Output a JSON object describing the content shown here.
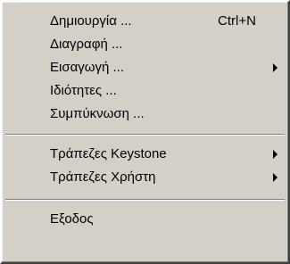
{
  "menu": {
    "items": [
      {
        "label": "Δημιουργία ...",
        "shortcut": "Ctrl+N"
      },
      {
        "label": "Διαγραφή ..."
      },
      {
        "label": "Εισαγωγή ...",
        "submenu": true
      },
      {
        "label": "Ιδιότητες ..."
      },
      {
        "label": "Συμπύκνωση ..."
      }
    ],
    "banks": [
      {
        "label": "Τράπεζες Keystone",
        "submenu": true
      },
      {
        "label": "Τράπεζες Χρήστη",
        "submenu": true
      }
    ],
    "exit": {
      "label": "Εξοδος"
    }
  }
}
